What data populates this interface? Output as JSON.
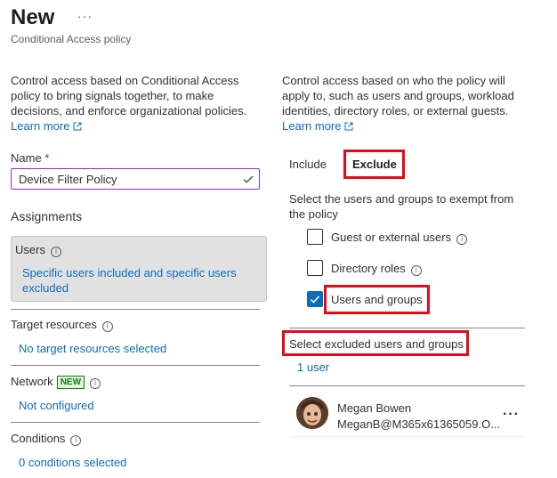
{
  "header": {
    "title": "New",
    "more": "···",
    "subtitle": "Conditional Access policy"
  },
  "left": {
    "description": "Control access based on Conditional Access policy to bring signals together, to make decisions, and enforce organizational policies.",
    "learn_more": "Learn more",
    "name_label": "Name",
    "name_required": "*",
    "name_value": "Device Filter Policy",
    "assignments_heading": "Assignments",
    "users": {
      "label": "Users",
      "value": "Specific users included and specific users excluded"
    },
    "target_resources": {
      "label": "Target resources",
      "value": "No target resources selected"
    },
    "network": {
      "label": "Network",
      "badge": "NEW",
      "value": "Not configured"
    },
    "conditions": {
      "label": "Conditions",
      "value": "0 conditions selected"
    }
  },
  "right": {
    "description": "Control access based on who the policy will apply to, such as users and groups, workload identities, directory roles, or external guests.",
    "learn_more": "Learn more",
    "tabs": [
      {
        "label": "Include",
        "active": false
      },
      {
        "label": "Exclude",
        "active": true
      }
    ],
    "exempt_text": "Select the users and groups to exempt from the policy",
    "options": [
      {
        "label": "Guest or external users",
        "checked": false,
        "info": true
      },
      {
        "label": "Directory roles",
        "checked": false,
        "info": true
      },
      {
        "label": "Users and groups",
        "checked": true,
        "info": false
      }
    ],
    "excluded_heading": "Select excluded users and groups",
    "user_count": "1 user",
    "person": {
      "name": "Megan Bowen",
      "email": "MeganB@M365x61365059.O..."
    },
    "row_more": "···"
  },
  "colors": {
    "accent": "#0f6cbd",
    "highlight_box": "#e30b17",
    "input_border": "#8a2be2",
    "success": "#107c10"
  }
}
